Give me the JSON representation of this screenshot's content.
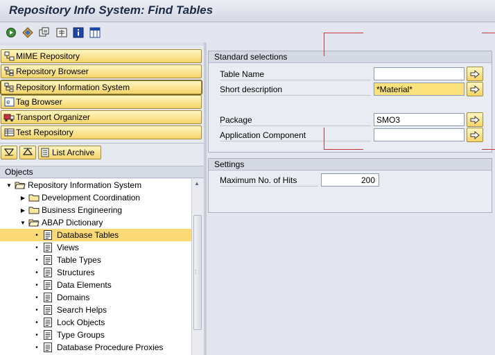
{
  "window": {
    "title": "Repository Info System: Find Tables"
  },
  "toolbar": {
    "icons": [
      "execute-icon",
      "other-objects-icon",
      "multiple-selection-icon",
      "all-selections-icon",
      "info-icon",
      "table-settings-icon"
    ]
  },
  "nav": {
    "items": [
      {
        "label": "MIME Repository",
        "icon": "mime-repository-icon"
      },
      {
        "label": "Repository Browser",
        "icon": "repository-browser-icon"
      },
      {
        "label": "Repository Information System",
        "icon": "repository-info-system-icon"
      },
      {
        "label": "Tag Browser",
        "icon": "tag-browser-icon"
      },
      {
        "label": "Transport Organizer",
        "icon": "transport-organizer-icon"
      },
      {
        "label": "Test Repository",
        "icon": "test-repository-icon"
      }
    ],
    "list_archive_label": "List Archive"
  },
  "tree": {
    "header": "Objects",
    "nodes": [
      {
        "label": "Repository Information System",
        "level": 0,
        "kind": "folder-open"
      },
      {
        "label": "Development Coordination",
        "level": 1,
        "kind": "folder"
      },
      {
        "label": "Business Engineering",
        "level": 1,
        "kind": "folder"
      },
      {
        "label": "ABAP Dictionary",
        "level": 1,
        "kind": "folder-open"
      },
      {
        "label": "Database Tables",
        "level": 2,
        "kind": "doc",
        "selected": true
      },
      {
        "label": "Views",
        "level": 2,
        "kind": "doc"
      },
      {
        "label": "Table Types",
        "level": 2,
        "kind": "doc"
      },
      {
        "label": "Structures",
        "level": 2,
        "kind": "doc"
      },
      {
        "label": "Data Elements",
        "level": 2,
        "kind": "doc"
      },
      {
        "label": "Domains",
        "level": 2,
        "kind": "doc"
      },
      {
        "label": "Search Helps",
        "level": 2,
        "kind": "doc"
      },
      {
        "label": "Lock Objects",
        "level": 2,
        "kind": "doc"
      },
      {
        "label": "Type Groups",
        "level": 2,
        "kind": "doc"
      },
      {
        "label": "Database Procedure Proxies",
        "level": 2,
        "kind": "doc"
      }
    ]
  },
  "selections": {
    "title": "Standard selections",
    "fields": [
      {
        "label": "Table Name",
        "value": ""
      },
      {
        "label": "Short description",
        "value": "*Material*"
      },
      {
        "label": "Package",
        "value": "SMO3"
      },
      {
        "label": "Application Component",
        "value": ""
      }
    ]
  },
  "settings": {
    "title": "Settings",
    "max_hits_label": "Maximum No. of Hits",
    "max_hits_value": "200"
  },
  "colors": {
    "button_yellow": "#f6d469",
    "selection_highlight": "#fbd974",
    "annotation_red": "#c8343c"
  }
}
